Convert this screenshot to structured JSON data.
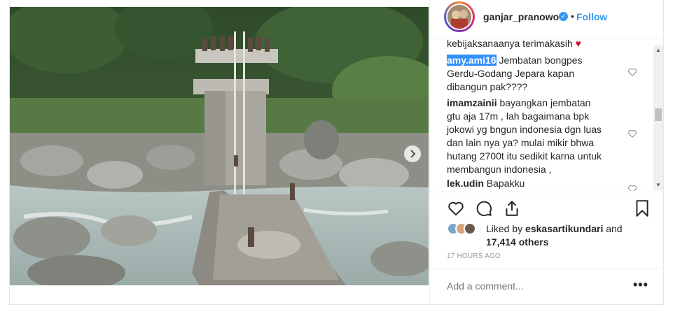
{
  "header": {
    "username": "ganjar_pranowo",
    "separator": "•",
    "follow_label": "Follow"
  },
  "comments": [
    {
      "user": "",
      "text": "kebijaksanaanya terimakasih",
      "emoji": "heart-emoji"
    },
    {
      "user": "amy.ami16",
      "text": " Jembatan bongpes Gerdu-Godang Jepara kapan dibangun pak????"
    },
    {
      "user": "imamzainii",
      "text": " bayangkan jembatan gtu aja 17m , lah bagaimana bpk jokowi yg bngun indonesia dgn luas dan lain nya ya? mulai mikir bhwa hutang 2700t itu sedikit karna untuk membangun indonesia ,"
    },
    {
      "user": "lek.udin",
      "text": " Bapakku @ganjar_pranowo"
    }
  ],
  "likes": {
    "prefix": "Liked by ",
    "liker": "eskasartikundari",
    "middle": " and",
    "count": "17,414 others"
  },
  "timestamp": "17 HOURS AGO",
  "add_comment": {
    "placeholder": "Add a comment..."
  },
  "more_label": "•••",
  "icons": [
    "heart-icon",
    "comment-icon",
    "share-icon",
    "bookmark-icon",
    "verified-badge-icon",
    "next-arrow-icon",
    "more-options-icon"
  ],
  "colors": {
    "link": "#3897f0",
    "text": "#262626",
    "muted": "#999999",
    "selection": "#3390ff"
  }
}
